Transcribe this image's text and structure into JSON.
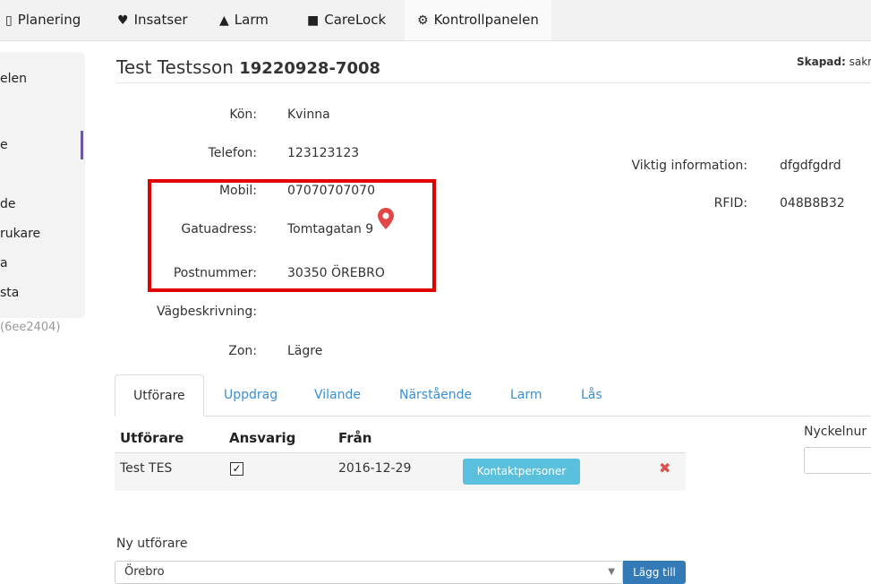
{
  "nav": {
    "items": [
      {
        "icon": "calendar-icon",
        "glyph": "📅",
        "label": "Planering"
      },
      {
        "icon": "heart-icon",
        "glyph": "♥",
        "label": "Insatser"
      },
      {
        "icon": "bell-icon",
        "glyph": "🔔",
        "label": "Larm"
      },
      {
        "icon": "lock-icon",
        "glyph": "🔒",
        "label": "CareLock"
      },
      {
        "icon": "gears-icon",
        "glyph": "⚙",
        "label": "Kontrollpanelen"
      }
    ]
  },
  "sidebar": {
    "items": [
      "elen",
      "e",
      "de",
      "rukare",
      "a",
      "sta"
    ],
    "version": "(6ee2404)"
  },
  "person": {
    "name": "Test Testsson",
    "ssn": "19220928-7008",
    "created_label": "Skapad:",
    "created_value": "sakr"
  },
  "fields": {
    "gender_label": "Kön:",
    "gender": "Kvinna",
    "phone_label": "Telefon:",
    "phone": "123123123",
    "mobile_label": "Mobil:",
    "mobile": "07070707070",
    "street_label": "Gatuadress:",
    "street": "Tomtagatan 9",
    "postal_label": "Postnummer:",
    "postal": "30350 ÖREBRO",
    "directions_label": "Vägbeskrivning:",
    "directions": "",
    "zone_label": "Zon:",
    "zone": "Lägre",
    "important_label": "Viktig information:",
    "important": "dfgdfgdrd",
    "rfid_label": "RFID:",
    "rfid": "048B8B32"
  },
  "tabs": [
    "Utförare",
    "Uppdrag",
    "Vilande",
    "Närstående",
    "Larm",
    "Lås"
  ],
  "table": {
    "headers": [
      "Utförare",
      "Ansvarig",
      "Från"
    ],
    "rows": [
      {
        "performer": "Test TES",
        "responsible": "✓",
        "from": "2016-12-29",
        "action": "Kontaktpersoner"
      }
    ]
  },
  "keynum_label": "Nyckelnur",
  "new_performer": {
    "label": "Ny utförare",
    "selected": "Örebro",
    "add_label": "Lägg till"
  }
}
